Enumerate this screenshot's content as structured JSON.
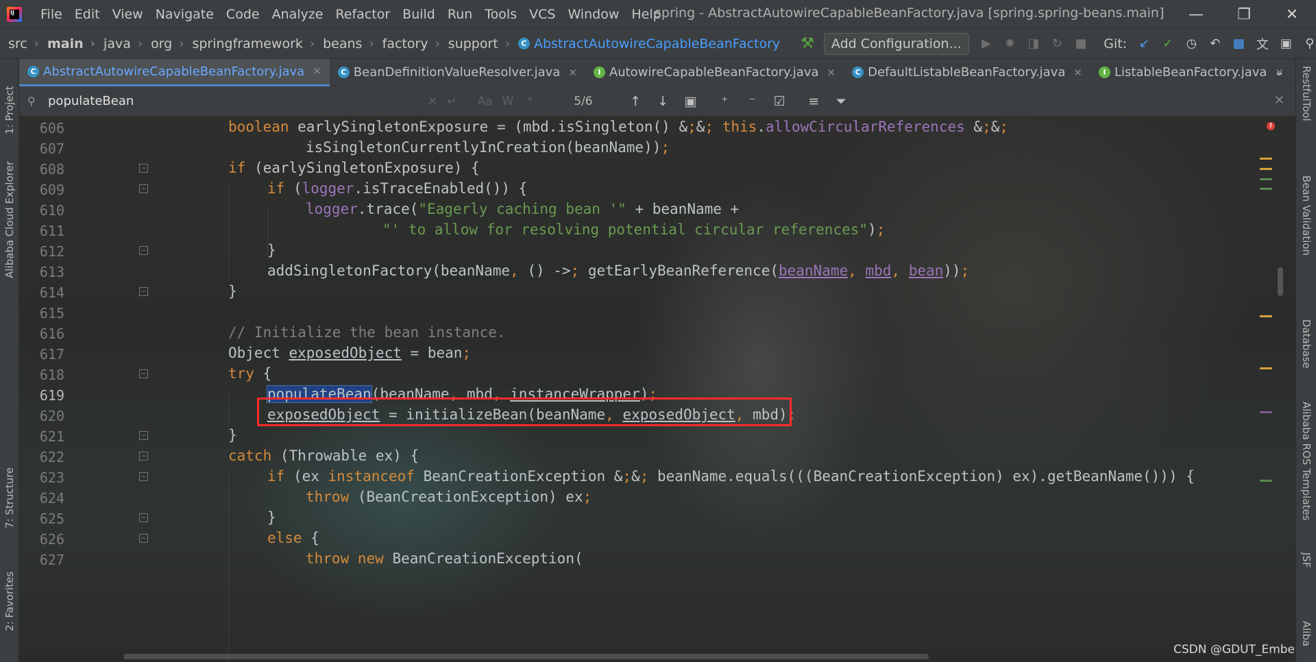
{
  "window": {
    "title": "spring - AbstractAutowireCapableBeanFactory.java [spring.spring-beans.main]",
    "app_logo_text": "IJ"
  },
  "menu": [
    "File",
    "Edit",
    "View",
    "Navigate",
    "Code",
    "Analyze",
    "Refactor",
    "Build",
    "Run",
    "Tools",
    "VCS",
    "Window",
    "Help"
  ],
  "breadcrumb": {
    "items": [
      "src",
      "main",
      "java",
      "org",
      "springframework",
      "beans",
      "factory",
      "support"
    ],
    "class_name": "AbstractAutowireCapableBeanFactory"
  },
  "toolbar": {
    "add_configuration": "Add Configuration...",
    "git_label": "Git:"
  },
  "tabs": [
    {
      "label": "AbstractAutowireCapableBeanFactory.java",
      "icon": "class-icon",
      "active": true
    },
    {
      "label": "BeanDefinitionValueResolver.java",
      "icon": "class-icon",
      "active": false
    },
    {
      "label": "AutowireCapableBeanFactory.java",
      "icon": "interface-icon",
      "active": false
    },
    {
      "label": "DefaultListableBeanFactory.java",
      "icon": "class-icon",
      "active": false
    },
    {
      "label": "ListableBeanFactory.java",
      "icon": "interface-icon",
      "active": false
    }
  ],
  "search": {
    "value": "populateBean",
    "match_case": "Aa",
    "words": "W",
    "regex": ".*",
    "match_count": "5/6"
  },
  "left_tools": [
    "1: Project",
    "Alibaba Cloud Explorer",
    "7: Structure",
    "2: Favorites"
  ],
  "right_tools": [
    "RestfulTool",
    "Bean Validation",
    "Database",
    "Alibaba ROS Templates",
    "JSF",
    "Aliba"
  ],
  "editor": {
    "current_line": 619,
    "lines": [
      {
        "no": 606,
        "text": "boolean earlySingletonExposure = (mbd.isSingleton() && this.allowCircularReferences &&"
      },
      {
        "no": 607,
        "text": "isSingletonCurrentlyInCreation(beanName));"
      },
      {
        "no": 608,
        "text": "if (earlySingletonExposure) {"
      },
      {
        "no": 609,
        "text": "if (logger.isTraceEnabled()) {"
      },
      {
        "no": 610,
        "text": "logger.trace(\"Eagerly caching bean '\" + beanName +"
      },
      {
        "no": 611,
        "text": "\"' to allow for resolving potential circular references\");"
      },
      {
        "no": 612,
        "text": "}"
      },
      {
        "no": 613,
        "text": "addSingletonFactory(beanName, () -> getEarlyBeanReference(beanName, mbd, bean));"
      },
      {
        "no": 614,
        "text": "}"
      },
      {
        "no": 615,
        "text": ""
      },
      {
        "no": 616,
        "text": "// Initialize the bean instance."
      },
      {
        "no": 617,
        "text": "Object exposedObject = bean;"
      },
      {
        "no": 618,
        "text": "try {"
      },
      {
        "no": 619,
        "text": "populateBean(beanName, mbd, instanceWrapper);"
      },
      {
        "no": 620,
        "text": "exposedObject = initializeBean(beanName, exposedObject, mbd);"
      },
      {
        "no": 621,
        "text": "}"
      },
      {
        "no": 622,
        "text": "catch (Throwable ex) {"
      },
      {
        "no": 623,
        "text": "if (ex instanceof BeanCreationException && beanName.equals(((BeanCreationException) ex).getBeanName())) {"
      },
      {
        "no": 624,
        "text": "throw (BeanCreationException) ex;"
      },
      {
        "no": 625,
        "text": "}"
      },
      {
        "no": 626,
        "text": "else {"
      },
      {
        "no": 627,
        "text": "throw new BeanCreationException("
      }
    ]
  },
  "watermark": "CSDN @GDUT_Ember",
  "colors": {
    "keyword": "#d58a3c",
    "field": "#9c75b8",
    "string": "#6a9a52",
    "comment": "#7f7f7f",
    "highlight_box": "#ff2b2b",
    "search_match_bg": "#214283"
  }
}
